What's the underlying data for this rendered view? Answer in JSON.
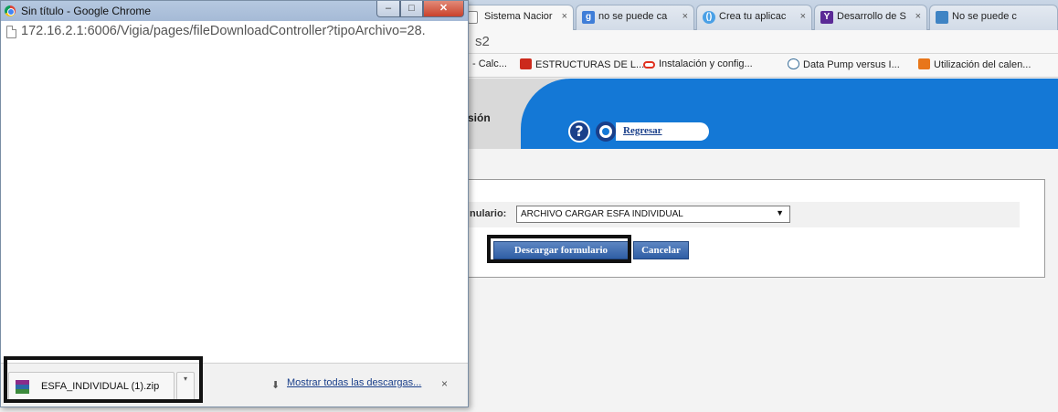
{
  "background_window": {
    "tabs": [
      {
        "label": "Sistema Nacior",
        "icon": "page-icon",
        "close": "×"
      },
      {
        "label": "no se puede ca",
        "icon": "google-plus-icon",
        "icon_text": "g",
        "color": "#3f7ed8",
        "close": "×"
      },
      {
        "label": "Crea tu aplicac",
        "icon": "circle-app-icon",
        "icon_text": "()",
        "color": "#4aa0e6",
        "close": "×"
      },
      {
        "label": "Desarrollo de S",
        "icon": "yahoo-icon",
        "icon_text": "Y",
        "color": "#5b2a96",
        "close": "×"
      },
      {
        "label": "No se puede c",
        "icon": "stackoverflow-icon",
        "color": "#3f84c4",
        "close": ""
      }
    ],
    "address_fragment": "s2",
    "bookmarks": [
      {
        "label": "- Calc...",
        "icon": "",
        "color": "#f7f7f7"
      },
      {
        "label": "ESTRUCTURAS DE L...",
        "icon": "youtube-icon",
        "color": "#cc2a1c"
      },
      {
        "label": "Instalación y config...",
        "icon": "oracle-icon",
        "color": "#e0301e"
      },
      {
        "label": "Data Pump versus I...",
        "icon": "wordpress-icon",
        "color": "#3a6f9a"
      },
      {
        "label": "Utilización del calen...",
        "icon": "orange-app-icon",
        "color": "#e8761a"
      }
    ],
    "page": {
      "header_partial_text": "sión",
      "help_symbol": "?",
      "back_link": "Regresar",
      "form_label_partial": "nulario:",
      "select_value": "ARCHIVO CARGAR ESFA INDIVIDUAL",
      "select_arrow": "▼",
      "download_button": "Descargar formulario",
      "cancel_button": "Cancelar"
    },
    "colors": {
      "banner_blue": "#1478d6",
      "button_blue": "#3a67aa"
    }
  },
  "popup_window": {
    "title": "Sin título - Google Chrome",
    "window_buttons": {
      "minimize": "–",
      "maximize": "□",
      "close": "✕"
    },
    "url": "172.16.2.1:6006/Vigia/pages/fileDownloadController?tipoArchivo=28.",
    "download_bar": {
      "filename": "ESFA_INDIVIDUAL (1).zip",
      "dropdown_arrow": "▾",
      "show_all_icon": "⬇",
      "show_all_label": "Mostrar todas las descargas...",
      "close": "×"
    }
  }
}
